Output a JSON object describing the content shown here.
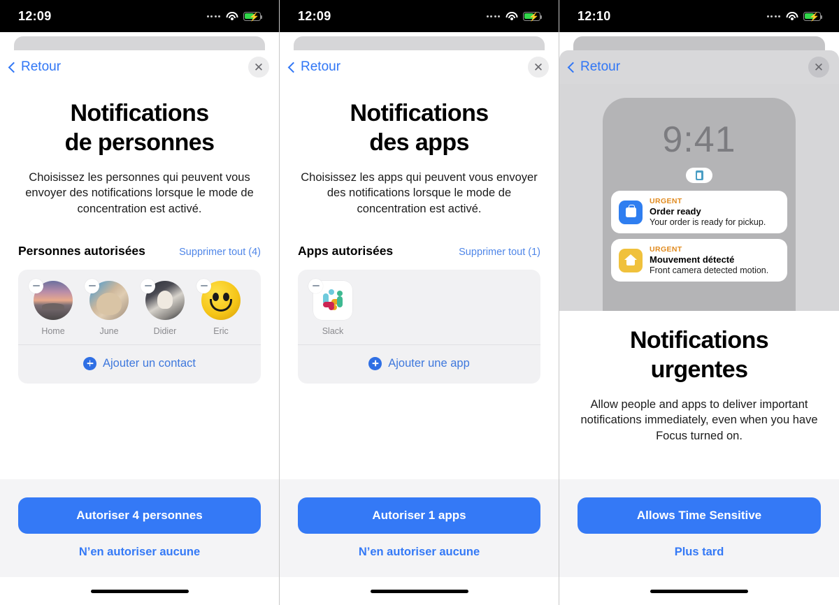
{
  "panels": [
    {
      "status": {
        "time": "12:09",
        "wifi_icon": "wifi-icon",
        "battery_icon": "battery-charging-icon",
        "signal_icon": "signal-dots-icon"
      },
      "nav": {
        "back_label": "Retour",
        "back_icon": "chevron-left-icon",
        "close_icon": "close-icon"
      },
      "title_line1": "Notifications",
      "title_line2": "de personnes",
      "subtitle": "Choisissez les personnes qui peuvent vous envoyer des notifications lorsque le mode de concentration est activé.",
      "section_title": "Personnes autorisées",
      "clear_link": "Supprimer tout (4)",
      "tiles": [
        {
          "label": "Home",
          "art": "a-home",
          "remove_icon": "remove-badge-icon"
        },
        {
          "label": "June",
          "art": "a-june",
          "remove_icon": "remove-badge-icon"
        },
        {
          "label": "Didier",
          "art": "a-didier",
          "remove_icon": "remove-badge-icon"
        },
        {
          "label": "Eric",
          "art": "a-eric",
          "remove_icon": "remove-badge-icon"
        }
      ],
      "add_label": "Ajouter un contact",
      "add_icon": "plus-circle-icon",
      "primary_button": "Autoriser 4 personnes",
      "secondary_button": "N’en autoriser aucune"
    },
    {
      "status": {
        "time": "12:09"
      },
      "nav": {
        "back_label": "Retour"
      },
      "title_line1": "Notifications",
      "title_line2": "des apps",
      "subtitle": "Choisissez les apps qui peuvent vous envoyer des notifications lorsque le mode de concentration est activé.",
      "section_title": "Apps autorisées",
      "clear_link": "Supprimer tout (1)",
      "tiles": [
        {
          "label": "Slack",
          "art": "slack-logo-icon",
          "remove_icon": "remove-badge-icon"
        }
      ],
      "add_label": "Ajouter une app",
      "add_icon": "plus-circle-icon",
      "primary_button": "Autoriser 1 apps",
      "secondary_button": "N’en autoriser aucune"
    },
    {
      "status": {
        "time": "12:10"
      },
      "nav": {
        "back_label": "Retour"
      },
      "mock": {
        "clock": "9:41",
        "focus_icon": "focus-badge-icon",
        "notifications": [
          {
            "tag": "URGENT",
            "title": "Order ready",
            "body": "Your order is ready for pickup.",
            "icon": "shopping-bag-icon",
            "color": "#2f7ef0"
          },
          {
            "tag": "URGENT",
            "title": "Mouvement détecté",
            "body": "Front camera detected motion.",
            "icon": "home-icon",
            "color": "#f0c13c"
          }
        ]
      },
      "title_line1": "Notifications",
      "title_line2": "urgentes",
      "subtitle": "Allow people and apps to deliver important notifications immediately, even when you have Focus turned on.",
      "primary_button": "Allows Time Sensitive",
      "secondary_button": "Plus tard"
    }
  ],
  "colors": {
    "accent": "#3479f6",
    "link": "#4f86e8",
    "urgent": "#e08a1e",
    "battery": "#32d74b"
  }
}
